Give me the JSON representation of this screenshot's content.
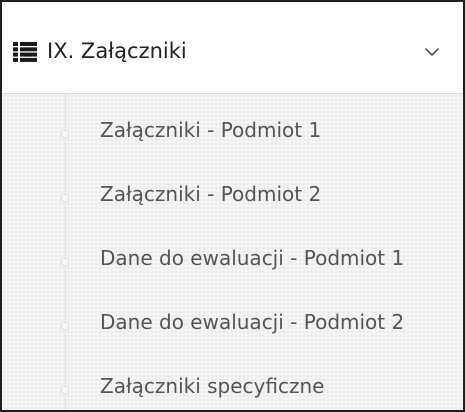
{
  "menu": {
    "header": {
      "icon": "list-icon",
      "title": "IX. Załączniki",
      "toggle_icon": "chevron-down-icon"
    },
    "items": [
      {
        "label": "Załączniki - Podmiot 1"
      },
      {
        "label": "Załączniki - Podmiot 2"
      },
      {
        "label": "Dane do ewaluacji - Podmiot 1"
      },
      {
        "label": "Dane do ewaluacji - Podmiot 2"
      },
      {
        "label": "Załączniki specyficzne"
      }
    ]
  }
}
